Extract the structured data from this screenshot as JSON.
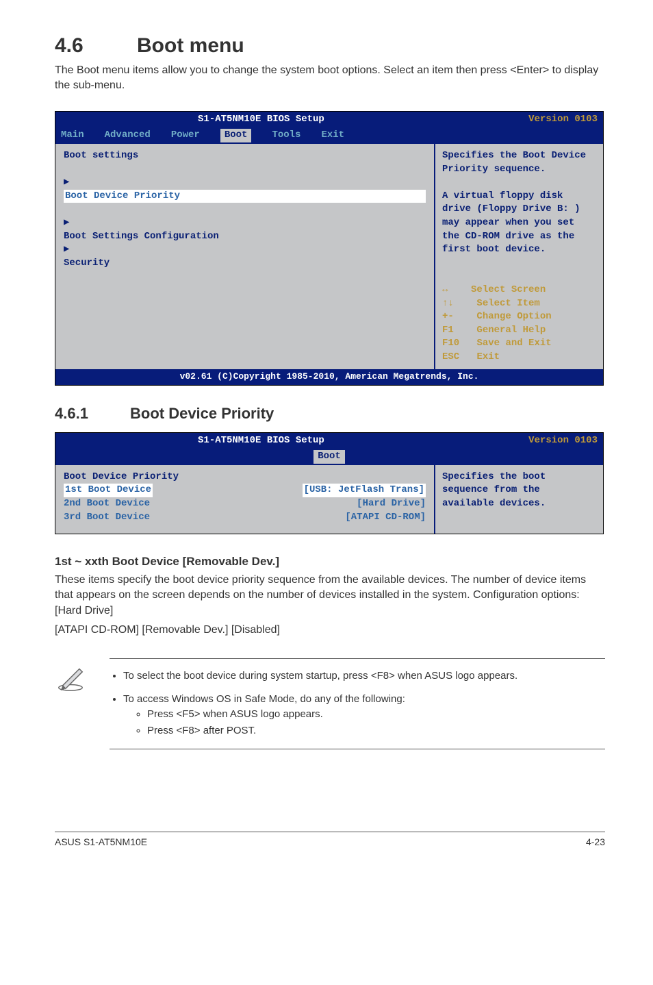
{
  "section": {
    "num": "4.6",
    "title": "Boot menu"
  },
  "intro": "The Boot menu items allow you to change the system boot options. Select an item then press <Enter> to display the sub-menu.",
  "bios1": {
    "setup_title": "S1-AT5NM10E BIOS Setup",
    "version": "Version 0103",
    "menubar": {
      "items": [
        "Main",
        "Advanced",
        "Power",
        "Boot",
        "Tools",
        "Exit"
      ],
      "selected": "Boot"
    },
    "left": {
      "header": "Boot settings",
      "items": [
        {
          "tri": "▶",
          "label": "Boot Device Priority",
          "selected": true
        },
        {
          "tri": "▶",
          "label": "Boot Settings Configuration",
          "selected": false
        },
        {
          "tri": "▶",
          "label": "Security",
          "selected": false
        }
      ]
    },
    "right": {
      "desc1": "Specifies the Boot Device Priority sequence.",
      "desc2": "A virtual floppy disk drive (Floppy Drive B: ) may appear when you set the CD-ROM drive as the first boot device.",
      "nav": [
        {
          "key": "↔",
          "label": "Select Screen"
        },
        {
          "key": "↑↓",
          "label": "Select Item"
        },
        {
          "key": "+-",
          "label": "Change Option"
        },
        {
          "key": "F1",
          "label": "General Help"
        },
        {
          "key": "F10",
          "label": "Save and Exit"
        },
        {
          "key": "ESC",
          "label": "Exit"
        }
      ]
    },
    "footer": "v02.61 (C)Copyright 1985-2010, American Megatrends, Inc."
  },
  "sub461": {
    "num": "4.6.1",
    "title": "Boot Device Priority"
  },
  "bios2": {
    "setup_title": "S1-AT5NM10E BIOS Setup",
    "version": "Version 0103",
    "menubar_sel": "Boot",
    "left": {
      "header": "Boot Device Priority",
      "rows": [
        {
          "name": "1st Boot Device",
          "value": "[USB: JetFlash Trans]",
          "selected": true
        },
        {
          "name": "2nd Boot Device",
          "value": "[Hard Drive]",
          "selected": false
        },
        {
          "name": "3rd Boot Device",
          "value": "[ATAPI CD-ROM]",
          "selected": false
        }
      ]
    },
    "right": {
      "desc": "Specifies the boot sequence from the available devices."
    }
  },
  "subsub": "1st ~ xxth Boot Device [Removable Dev.]",
  "bodypara1": "These items specify the boot device priority sequence from the available devices. The number of device items that appears on the screen depends on the number of devices installed in the system. Configuration options: [Hard Drive]",
  "bodypara2": " [ATAPI CD-ROM] [Removable Dev.] [Disabled]",
  "note": {
    "b1": "To select the boot device during system startup, press <F8> when ASUS logo appears.",
    "b2": "To access Windows OS in Safe Mode, do any of the following:",
    "b2a": "Press <F5> when ASUS logo appears.",
    "b2b": "Press <F8> after POST."
  },
  "pagefooter": {
    "left": "ASUS S1-AT5NM10E",
    "right": "4-23"
  }
}
